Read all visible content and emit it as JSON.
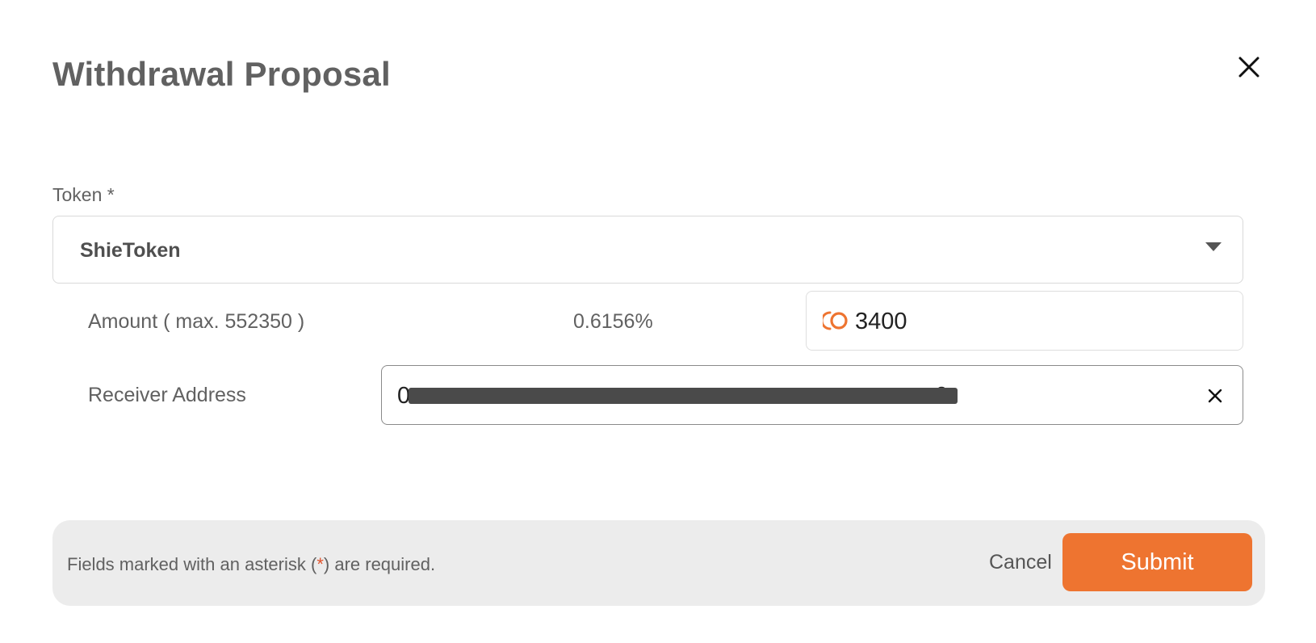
{
  "dialog": {
    "title": "Withdrawal Proposal",
    "close_icon": "close-icon"
  },
  "token": {
    "label": "Token *",
    "selected": "ShieToken",
    "caret_icon": "caret-down-icon"
  },
  "amount": {
    "label": "Amount ( max. 552350 )",
    "percent": "0.6156%",
    "value": "3400",
    "token_icon": "token-logo-icon",
    "token_icon_color": "#ee7430"
  },
  "receiver": {
    "label": "Receiver Address",
    "value_prefix": "0",
    "value_suffix": "0",
    "redacted": true,
    "clear_icon": "clear-x-icon"
  },
  "footer": {
    "note_before": "Fields marked with an asterisk (",
    "asterisk": "*",
    "note_after": ") are required.",
    "cancel_label": "Cancel",
    "submit_label": "Submit",
    "submit_color": "#ee7430",
    "asterisk_color": "#e0522b"
  }
}
